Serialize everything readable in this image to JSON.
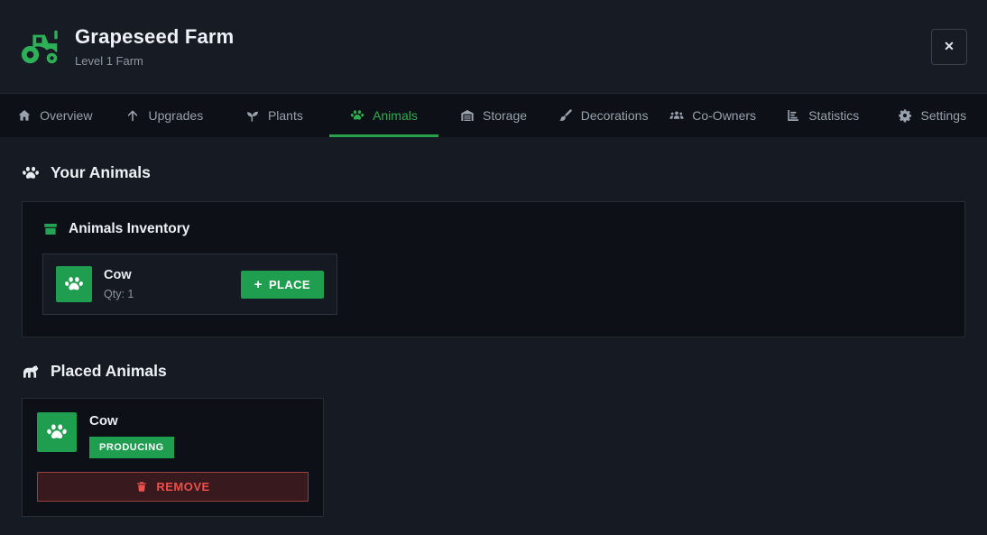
{
  "header": {
    "title": "Grapeseed Farm",
    "subtitle": "Level 1 Farm",
    "close_label": "✕"
  },
  "tabs": [
    {
      "label": "Overview",
      "icon": "home-icon",
      "active": false
    },
    {
      "label": "Upgrades",
      "icon": "arrow-up-icon",
      "active": false
    },
    {
      "label": "Plants",
      "icon": "seedling-icon",
      "active": false
    },
    {
      "label": "Animals",
      "icon": "paw-icon",
      "active": true
    },
    {
      "label": "Storage",
      "icon": "warehouse-icon",
      "active": false
    },
    {
      "label": "Decorations",
      "icon": "paintbrush-icon",
      "active": false
    },
    {
      "label": "Co-Owners",
      "icon": "users-icon",
      "active": false
    },
    {
      "label": "Statistics",
      "icon": "chart-icon",
      "active": false
    },
    {
      "label": "Settings",
      "icon": "gear-icon",
      "active": false
    }
  ],
  "your_animals": {
    "title": "Your Animals",
    "inventory": {
      "title": "Animals Inventory",
      "items": [
        {
          "name": "Cow",
          "qty_label": "Qty: 1",
          "place_label": "PLACE",
          "plus_glyph": "+"
        }
      ]
    },
    "placed": {
      "title": "Placed Animals",
      "items": [
        {
          "name": "Cow",
          "status": "PRODUCING",
          "remove_label": "REMOVE"
        }
      ]
    }
  },
  "colors": {
    "accent_green": "#1f9e4f",
    "active_tab_green": "#2eab51",
    "tractor_green": "#2db158",
    "danger_red": "#ee4f4b",
    "danger_bg": "#38191d",
    "header_bg": "#171b23",
    "tabbar_bg": "#0d1016",
    "panel_bg": "#0d1117",
    "page_bg": "#161a22"
  }
}
